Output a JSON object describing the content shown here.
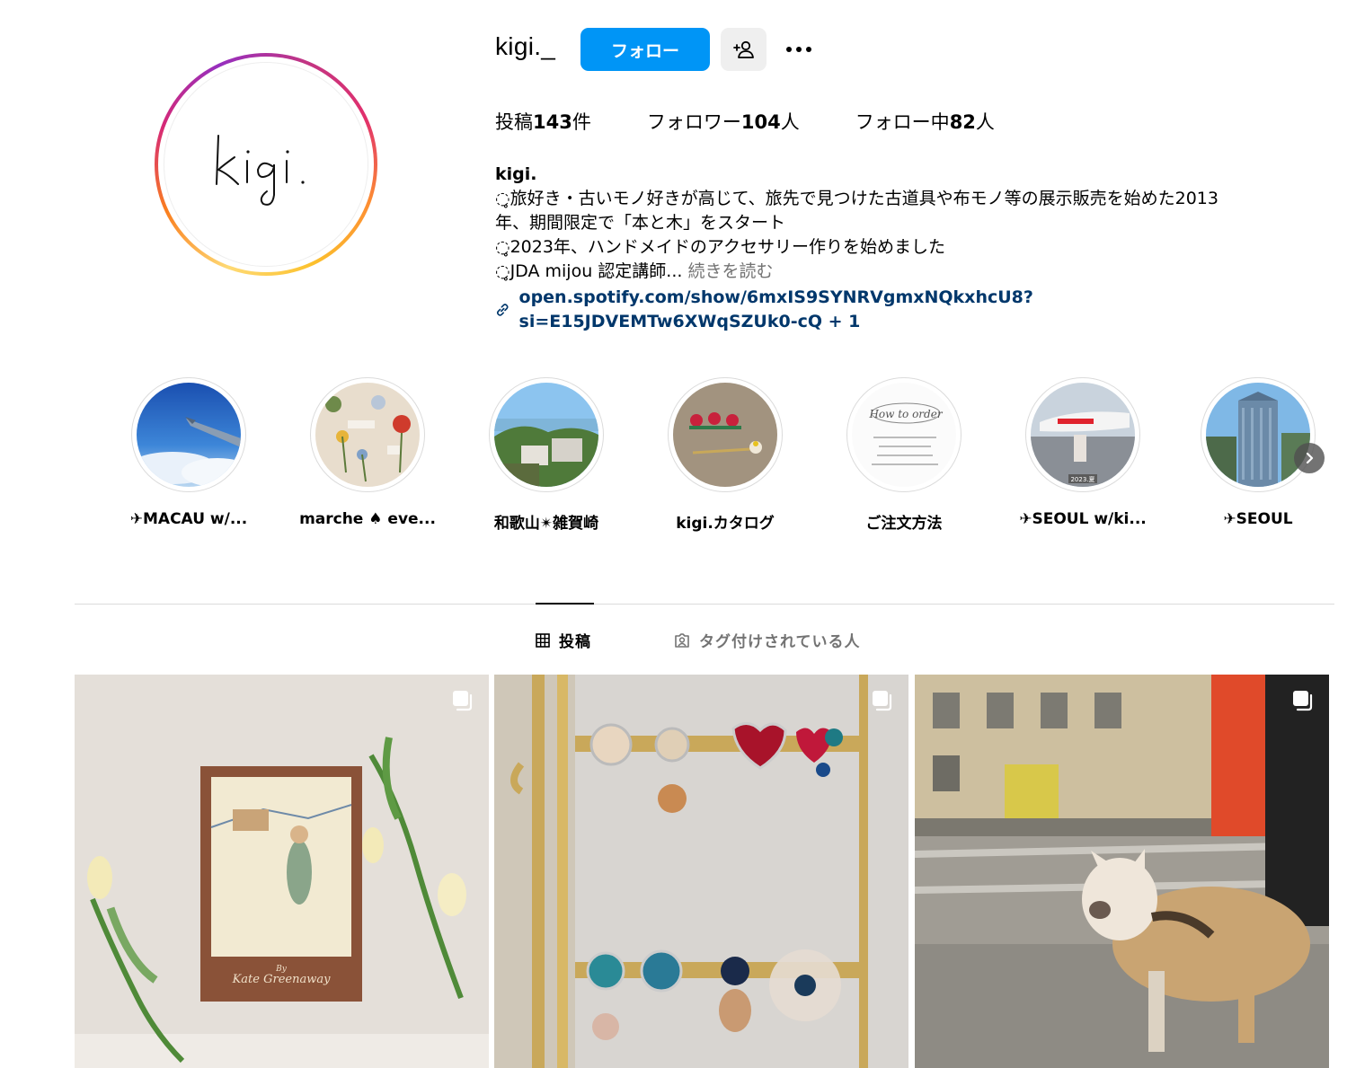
{
  "profile": {
    "username": "kigi._",
    "avatar_text": "kigi.",
    "follow_label": "フォロー",
    "stats": {
      "posts_label": "投稿",
      "posts_count": "143",
      "posts_unit": "件",
      "followers_label": "フォロワー",
      "followers_count": "104",
      "followers_unit": "人",
      "following_label": "フォロー中",
      "following_count": "82",
      "following_unit": "人"
    },
    "bio": {
      "name": "kigi.",
      "line1": "◌̥旅好き・古いモノ好きが高じて、旅先で見つけた古道具や布モノ等の展示販売を始めた2013",
      "line2": "年、期間限定で「本と木」をスタート",
      "line3": "◌̥2023年、ハンドメイドのアクセサリー作りを始めました",
      "line4": "◌̥JDA mijou 認定講師...",
      "more": "続きを読む",
      "link": "open.spotify.com/show/6mxIS9SYNRVgmxNQkxhcU8?si=E15JDVEMTw6XWqSZUk0-cQ + 1"
    }
  },
  "highlights": [
    {
      "label": "✈MACAU w/..."
    },
    {
      "label": "marche ♠ eve..."
    },
    {
      "label": "和歌山✴雑賀崎"
    },
    {
      "label": "kigi.カタログ"
    },
    {
      "label": "ご注文方法",
      "cover_title": "How to order"
    },
    {
      "label": "✈SEOUL w/ki...",
      "cover_caption": "2023.夏"
    },
    {
      "label": "✈SEOUL"
    }
  ],
  "tabs": {
    "posts": "投稿",
    "tagged": "タグ付けされている人"
  },
  "posts": [
    {
      "book_title": "Kate Greenaway",
      "book_by": "By"
    },
    {},
    {}
  ],
  "colors": {
    "primary_button": "#0095f6",
    "link": "#00376b",
    "muted": "#737373"
  }
}
